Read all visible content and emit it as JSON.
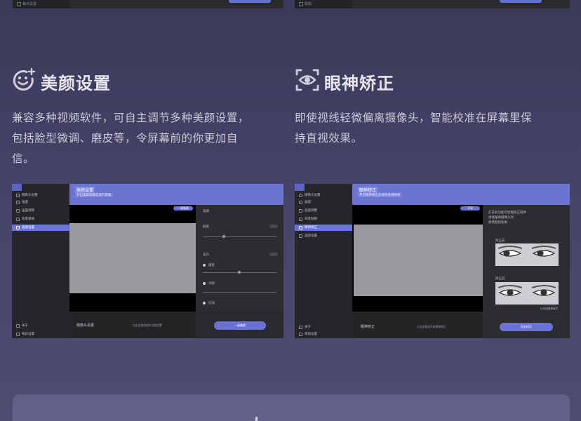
{
  "top_left_shot": {
    "sidebar_label": "每日设置"
  },
  "top_right_shot": {
    "sidebar_label": "帮助"
  },
  "beauty": {
    "title": "美颜设置",
    "icon": "smile-sparkle-icon",
    "desc_lines": [
      "兼容多种视频软件，可自主调节多种美颜设置，",
      "包括脸型微调、磨皮等，令屏幕前的你更加自",
      "信。"
    ],
    "shot": {
      "header_title": "美颜设置",
      "header_sub": "开启美颜效果后调节参数",
      "sidebar_items": [
        "摄像头设置",
        "画面",
        "画面调整",
        "背景替换",
        "美颜设置"
      ],
      "sidebar_bottom": [
        "关于",
        "每日设置"
      ],
      "top_button": "一键美颜",
      "panel_title": "美颜",
      "panel_labels": [
        "磨皮",
        "美白",
        "瘦脸",
        "大眼",
        "红润"
      ],
      "bottom_label": "摄像头设置",
      "bottom_note": "点击此按钮保存当前设置",
      "bottom_button": "一键美颜"
    }
  },
  "gaze": {
    "title": "眼神矫正",
    "icon": "eye-focus-icon",
    "desc_lines": [
      "即使视线轻微偏离摄像头，智能校准在屏幕里保",
      "持直视效果。"
    ],
    "shot": {
      "header_title": "眼神矫正",
      "header_sub": "开启眼神矫正后保持直视效果",
      "sidebar_items": [
        "摄像头设置",
        "画面",
        "画面调整",
        "背景替换",
        "眼神矫正",
        "美颜设置"
      ],
      "sidebar_bottom": [
        "关于",
        "每日设置"
      ],
      "top_button": "开启",
      "panel_lines": [
        "打开此功能可智能矫正眼神",
        "视线偏离摄像头时",
        "保持直视效果"
      ],
      "before_label": "矫正前",
      "after_label": "矫正后",
      "after_note": "已开启眼神矫正",
      "bottom_label": "眼神矫正",
      "bottom_note": "点击此按钮开启眼神矫正",
      "bottom_button": "开启矫正"
    }
  }
}
